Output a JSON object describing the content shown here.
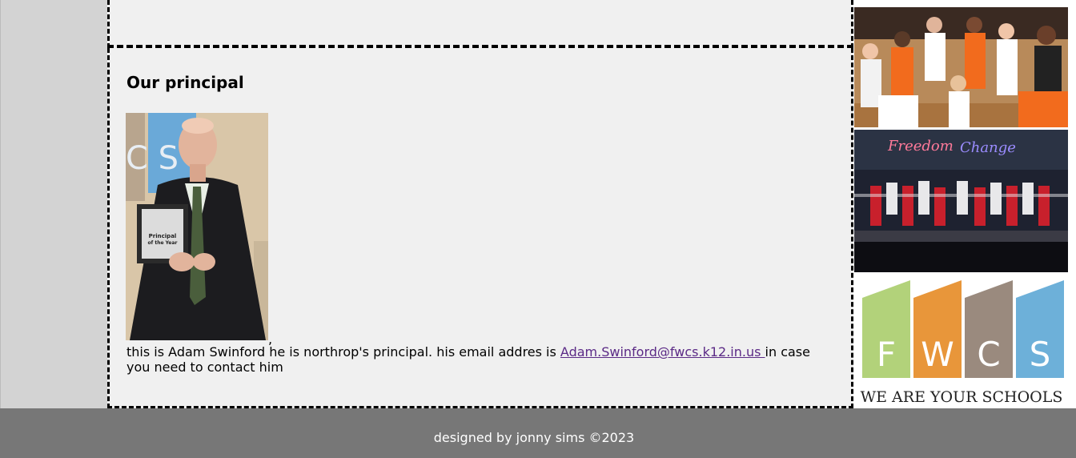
{
  "section": {
    "heading": "Our principal",
    "comma": ",",
    "text_before": "this is Adam Swinford he is northrop's principal. his email addres is ",
    "email_link": "Adam.Swinford@fwcs.k12.in.us ",
    "text_after": "in case you need to contact him"
  },
  "photo": {
    "plaque_line1": "Principal",
    "plaque_line2": "of the Year"
  },
  "sidebar": {
    "dance_sign_1": "Freedom",
    "dance_sign_2": "Change",
    "logo_letters": [
      "F",
      "W",
      "C",
      "S"
    ],
    "logo_tagline": "WE ARE YOUR SCHOOLS",
    "logo_colors": [
      "#b2d27a",
      "#e8963a",
      "#9a8a7e",
      "#6db0d9"
    ]
  },
  "footer": {
    "credit": "designed by jonny sims ©2023"
  }
}
